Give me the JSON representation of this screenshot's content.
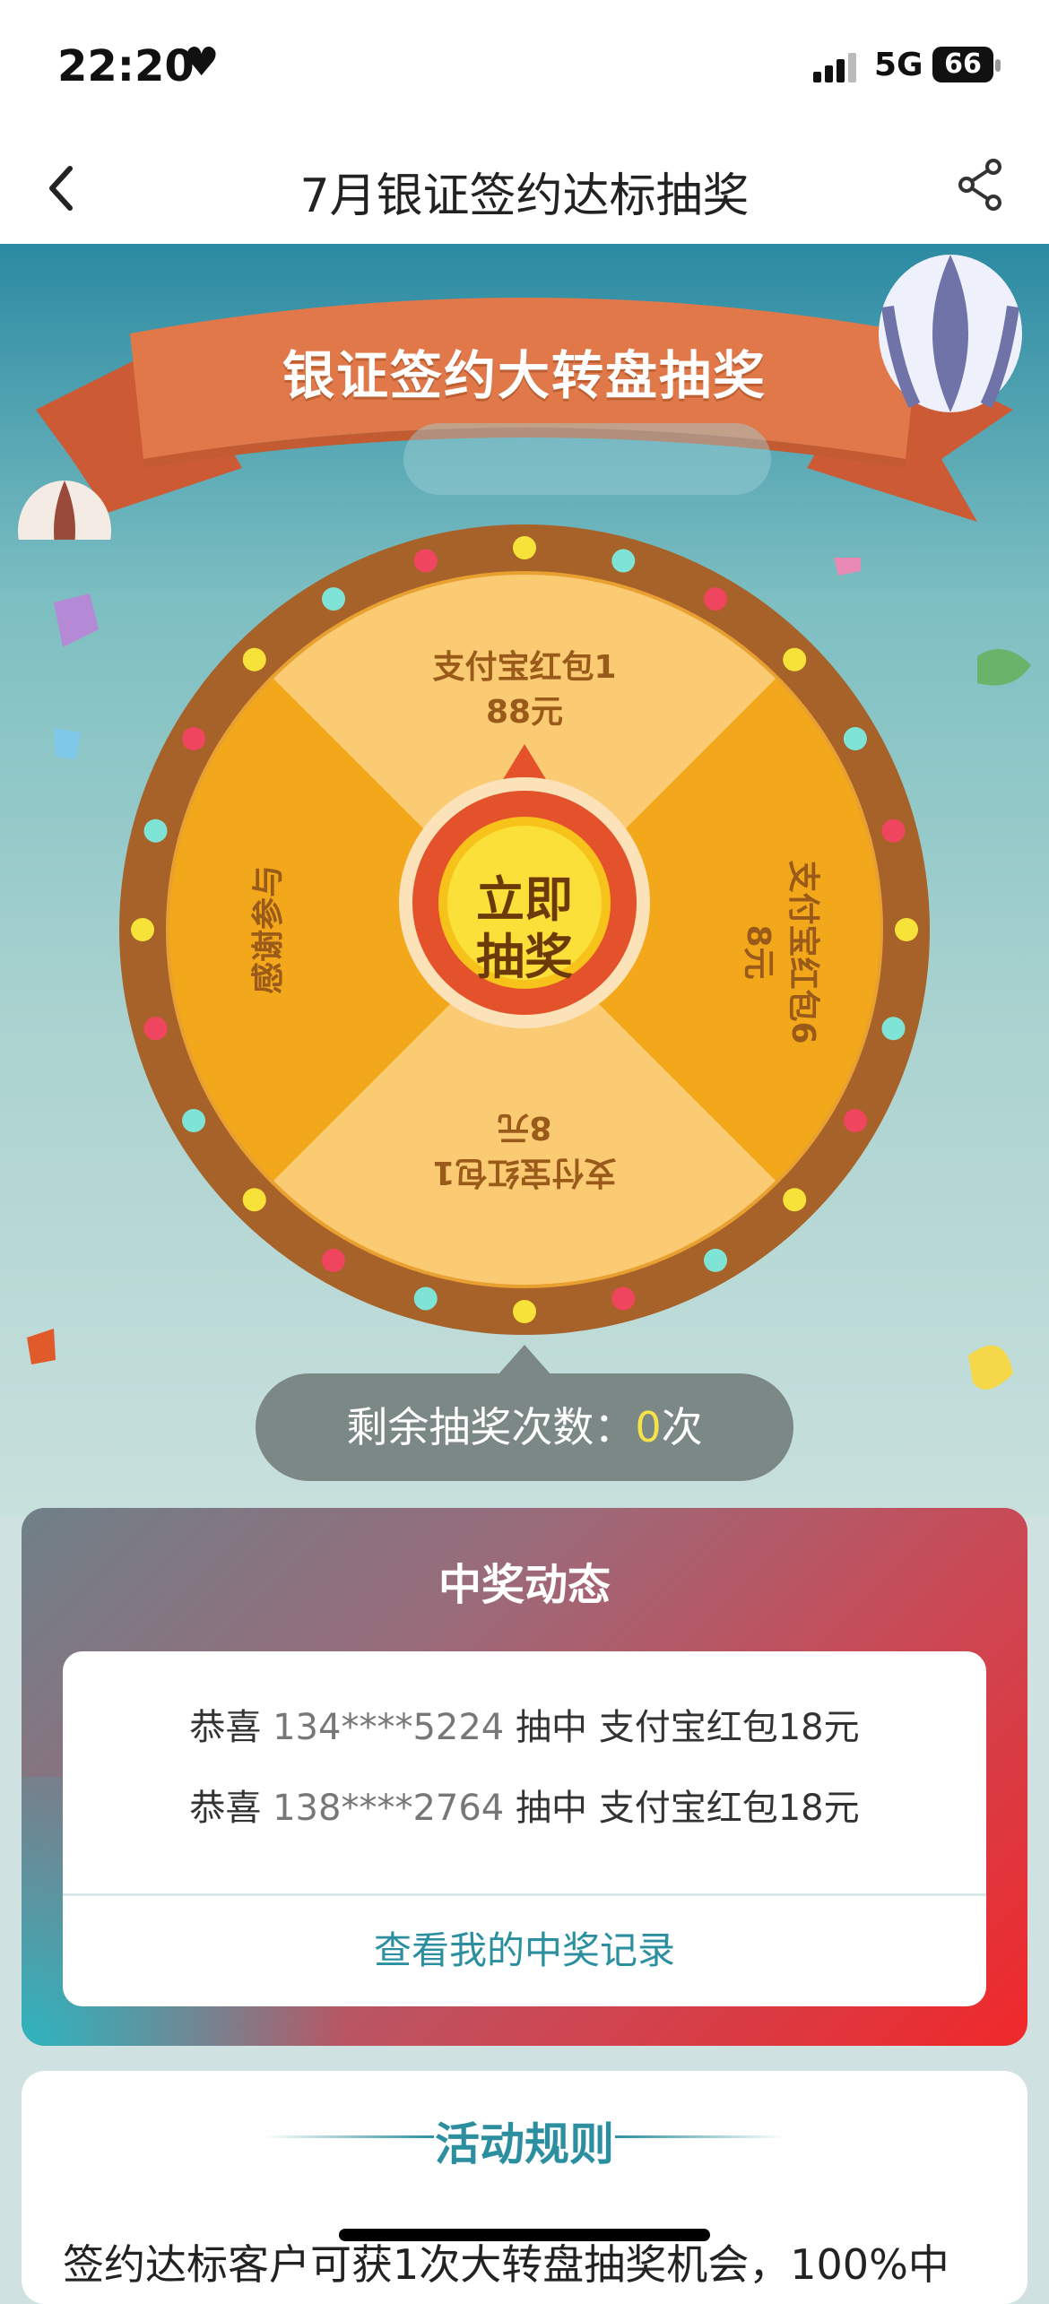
{
  "status": {
    "time": "22:20",
    "network": "5G",
    "battery": "66"
  },
  "nav": {
    "title": "7月银证签约达标抽奖"
  },
  "banner": {
    "title": "银证签约大转盘抽奖"
  },
  "wheel": {
    "prizes": [
      {
        "line1": "支付宝红包1",
        "line2": "88元"
      },
      {
        "line1": "支付宝红包6",
        "line2": "8元"
      },
      {
        "line1": "支付宝红包1",
        "line2": "8元"
      },
      {
        "line1": "感谢参与"
      }
    ],
    "button_line1": "立即",
    "button_line2": "抽奖"
  },
  "remaining": {
    "label": "剩余抽奖次数：",
    "count": "0",
    "unit": "次"
  },
  "winners": {
    "title": "中奖动态",
    "rows": [
      {
        "prefix": "恭喜",
        "phone": "134****5224",
        "action": "抽中",
        "prize": "支付宝红包18元"
      },
      {
        "prefix": "恭喜",
        "phone": "138****2764",
        "action": "抽中",
        "prize": "支付宝红包18元"
      }
    ],
    "link": "查看我的中奖记录"
  },
  "rules": {
    "title": "活动规则",
    "text": "签约达标客户可获1次大转盘抽奖机会，100%中"
  },
  "colors": {
    "accent": "#2c8fa0",
    "banner": "#e0784a",
    "wheel_rim": "#a7622a",
    "wheel_light": "#fbcb74",
    "wheel_dark": "#efa912"
  }
}
